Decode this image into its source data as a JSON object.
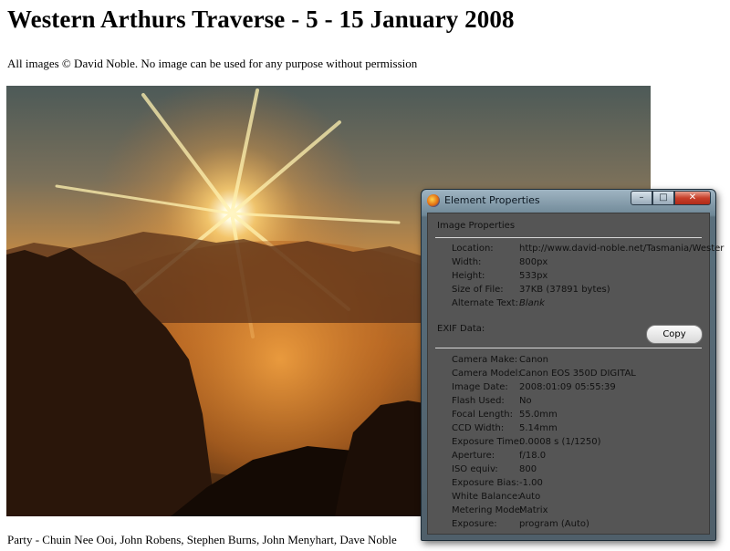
{
  "page": {
    "title": "Western Arthurs Traverse - 5 - 15 January 2008",
    "copyright": "All images © David Noble. No image can be used for any purpose without permission",
    "caption": "Party - Chuin Nee Ooi, John Robens, Stephen Burns, John Menyhart, Dave Noble"
  },
  "dialog": {
    "title": "Element Properties",
    "buttons": {
      "minimize": "–",
      "maximize": "□",
      "close": "✕"
    },
    "image_properties": {
      "heading": "Image Properties",
      "rows": [
        {
          "label": "Location:",
          "value": "http://www.david-noble.net/Tasmania/Wester"
        },
        {
          "label": "Width:",
          "value": "800px"
        },
        {
          "label": "Height:",
          "value": "533px"
        },
        {
          "label": "Size of File:",
          "value": "37KB (37891 bytes)"
        },
        {
          "label": "Alternate Text:",
          "value": "Blank"
        }
      ]
    },
    "exif": {
      "heading": "EXIF Data:",
      "copy_label": "Copy",
      "rows": [
        {
          "label": "Camera Make:",
          "value": "Canon"
        },
        {
          "label": "Camera Model:",
          "value": "Canon EOS 350D DIGITAL"
        },
        {
          "label": "Image Date:",
          "value": "2008:01:09 05:55:39"
        },
        {
          "label": "Flash Used:",
          "value": "No"
        },
        {
          "label": "Focal Length:",
          "value": "55.0mm"
        },
        {
          "label": "CCD Width:",
          "value": "5.14mm"
        },
        {
          "label": "Exposure Time:",
          "value": "0.0008 s (1/1250)"
        },
        {
          "label": "Aperture:",
          "value": "f/18.0"
        },
        {
          "label": "ISO equiv:",
          "value": "800"
        },
        {
          "label": "Exposure Bias:",
          "value": "-1.00"
        },
        {
          "label": "White Balance:",
          "value": "Auto"
        },
        {
          "label": "Metering Mode:",
          "value": "Matrix"
        },
        {
          "label": "Exposure:",
          "value": "program (Auto)"
        }
      ]
    }
  },
  "icons": {
    "app": "firefox-icon",
    "minimize": "minimize-icon",
    "maximize": "maximize-icon",
    "close": "close-icon"
  }
}
